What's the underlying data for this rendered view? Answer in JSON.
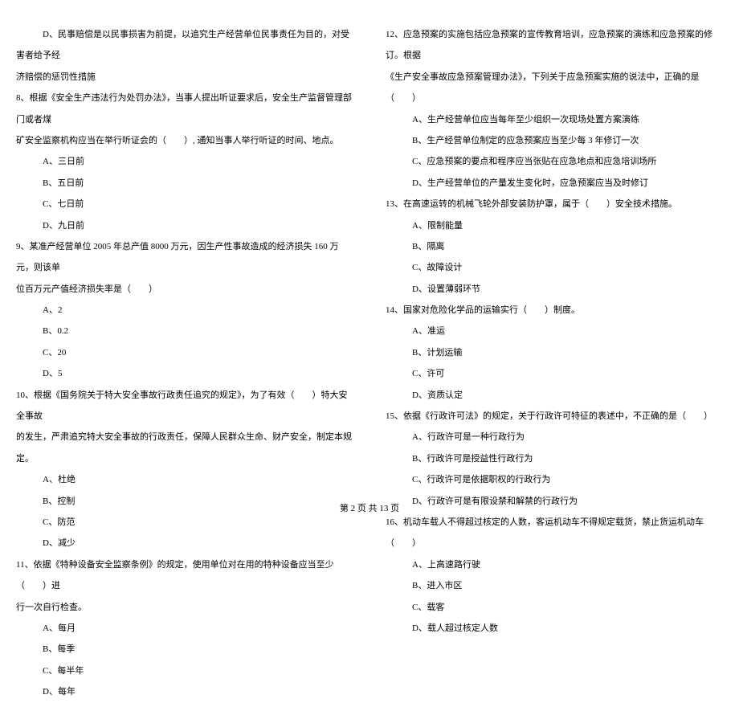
{
  "left_column": {
    "q7_option_d_line1": "D、民事赔偿是以民事损害为前提，以追究生产经营单位民事责任为目的，对受害者给予经",
    "q7_option_d_line2": "济赔偿的惩罚性措施",
    "q8_text": "8、根据《安全生产违法行为处罚办法》，当事人提出听证要求后，安全生产监督管理部门或者煤",
    "q8_text2": "矿安全监察机构应当在举行听证会的（　　）,  通知当事人举行听证的时间、地点。",
    "q8_a": "A、三日前",
    "q8_b": "B、五日前",
    "q8_c": "C、七日前",
    "q8_d": "D、九日前",
    "q9_text": "9、某准产经营单位 2005 年总产值 8000 万元，因生产性事故造成的经济损失 160 万元，则该单",
    "q9_text2": "位百万元产值经济损失率是（　　）",
    "q9_a": "A、2",
    "q9_b": "B、0.2",
    "q9_c": "C、20",
    "q9_d": "D、5",
    "q10_text": "10、根据《国务院关于特大安全事故行政责任追究的规定》，为了有效（　　）特大安全事故",
    "q10_text2": "的发生，严肃追究特大安全事故的行政责任，保障人民群众生命、财产安全，制定本规定。",
    "q10_a": "A、杜绝",
    "q10_b": "B、控制",
    "q10_c": "C、防范",
    "q10_d": "D、减少",
    "q11_text": "11、依据《特种设备安全监察条例》的规定，使用单位对在用的特种设备应当至少（　　）进",
    "q11_text2": "行一次自行检查。",
    "q11_a": "A、每月",
    "q11_b": "B、每季",
    "q11_c": "C、每半年",
    "q11_d": "D、每年"
  },
  "right_column": {
    "q12_text": "12、应急预案的实施包括应急预案的宣传教育培训，应急预案的演练和应急预案的修订。根据",
    "q12_text2": "《生产安全事故应急预案管理办法》，下列关于应急预案实施的说法中，正确的是（　　）",
    "q12_a": "A、生产经营单位应当每年至少组织一次现场处置方案演练",
    "q12_b": "B、生产经营单位制定的应急预案应当至少每 3 年修订一次",
    "q12_c": "C、应急预案的要点和程序应当张贴在应急地点和应急培训场所",
    "q12_d": "D、生产经营单位的产量发生变化时，应急预案应当及时修订",
    "q13_text": "13、在高速运转的机械飞轮外部安装防护罩，属于（　　）安全技术措施。",
    "q13_a": "A、限制能量",
    "q13_b": "B、隔离",
    "q13_c": "C、故障设计",
    "q13_d": "D、设置薄弱环节",
    "q14_text": "14、国家对危险化学品的运输实行（　　）制度。",
    "q14_a": "A、准运",
    "q14_b": "B、计划运输",
    "q14_c": "C、许可",
    "q14_d": "D、资质认定",
    "q15_text": "15、依据《行政许可法》的规定，关于行政许可特征的表述中，不正确的是（　　）",
    "q15_a": "A、行政许可是一种行政行为",
    "q15_b": "B、行政许可是授益性行政行为",
    "q15_c": "C、行政许可是依据职权的行政行为",
    "q15_d": "D、行政许可是有限设禁和解禁的行政行为",
    "q16_text": "16、机动车载人不得超过核定的人数，客运机动车不得规定载货，禁止货运机动车（　　）",
    "q16_a": "A、上高速路行驶",
    "q16_b": "B、进入市区",
    "q16_c": "C、载客",
    "q16_d": "D、载人超过核定人数"
  },
  "footer": "第 2 页 共 13 页"
}
